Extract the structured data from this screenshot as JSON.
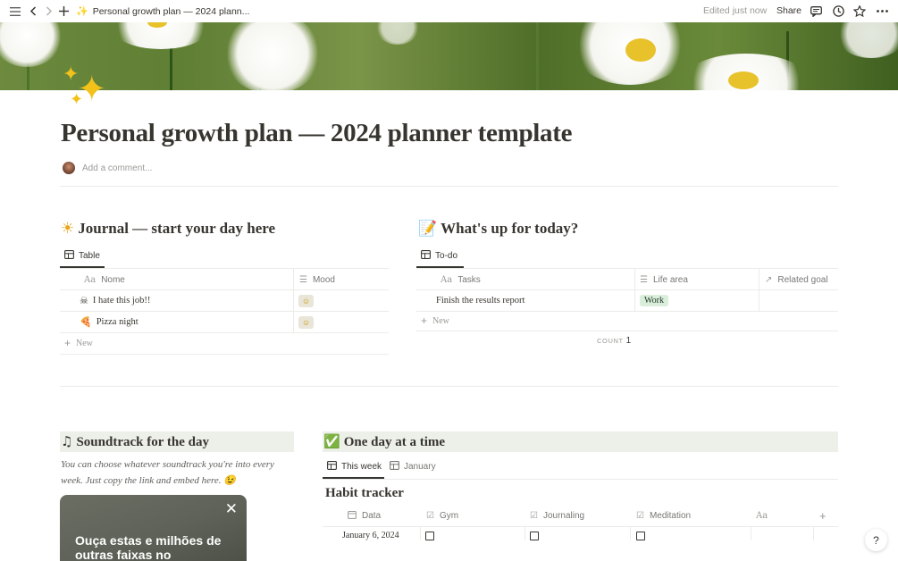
{
  "topbar": {
    "breadcrumb_icon": "✨",
    "breadcrumb_title": "Personal growth plan — 2024 plann...",
    "edited": "Edited just now",
    "share": "Share"
  },
  "page": {
    "icon": "sparkles-icon",
    "title": "Personal growth plan — 2024 planner template",
    "comment_placeholder": "Add a comment..."
  },
  "journal": {
    "emoji": "☀",
    "heading": "Journal — start your day here",
    "view_tab": "Table",
    "columns": [
      "Nome",
      "Mood"
    ],
    "rows": [
      {
        "icon": "☠",
        "name": "I hate this job!!",
        "mood": "☺"
      },
      {
        "icon": "🍕",
        "name": "Pizza night",
        "mood": "☺"
      }
    ],
    "new_label": "New"
  },
  "today": {
    "emoji": "📝",
    "heading": "What's up for today?",
    "view_tab": "To-do",
    "columns": [
      "Tasks",
      "Life area",
      "Related goal"
    ],
    "rows": [
      {
        "task": "Finish the results report",
        "area": "Work",
        "goal": ""
      }
    ],
    "new_label": "New",
    "count_label": "COUNT",
    "count_value": "1",
    "colors": {
      "work_tag_bg": "#dbeddb"
    }
  },
  "soundtrack": {
    "emoji": "♫",
    "heading": "Soundtrack for the day",
    "line1": "You can choose whatever soundtrack you're into every",
    "line2": "week. Just copy the link and embed here. 😉",
    "embed_text": "Ouça estas e milhões de outras faixas no"
  },
  "oneday": {
    "emoji": "✅",
    "heading": "One day at a time",
    "tabs": [
      "This week",
      "January"
    ],
    "habit_heading": "Habit tracker",
    "columns": [
      "Data",
      "Gym",
      "Journaling",
      "Meditation"
    ],
    "rows": [
      {
        "date": "January 6, 2024"
      }
    ]
  },
  "help_label": "?"
}
